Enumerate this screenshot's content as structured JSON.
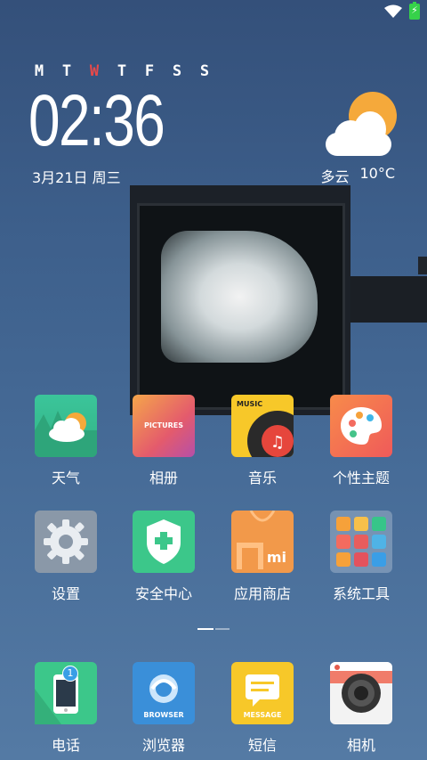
{
  "status": {
    "battery_icon": "battery-charging-icon",
    "wifi_icon": "wifi-icon"
  },
  "clock": {
    "weekdays": [
      "M",
      "T",
      "W",
      "T",
      "F",
      "S",
      "S"
    ],
    "active_day_index": 2,
    "time": "02:36",
    "date": "3月21日 周三"
  },
  "weather": {
    "condition": "多云",
    "temperature": "10°C",
    "icon": "partly-cloudy-icon"
  },
  "apps": [
    {
      "label": "天气",
      "icon": "weather-app-icon"
    },
    {
      "label": "相册",
      "icon": "gallery-app-icon",
      "icon_text": "PICTURES"
    },
    {
      "label": "音乐",
      "icon": "music-app-icon",
      "icon_text": "MUSIC"
    },
    {
      "label": "个性主题",
      "icon": "themes-app-icon"
    },
    {
      "label": "设置",
      "icon": "settings-app-icon"
    },
    {
      "label": "安全中心",
      "icon": "security-app-icon"
    },
    {
      "label": "应用商店",
      "icon": "app-store-icon",
      "icon_text": "mi"
    },
    {
      "label": "系统工具",
      "icon": "system-tools-folder-icon"
    }
  ],
  "dock": [
    {
      "label": "电话",
      "icon": "phone-app-icon",
      "badge": "1"
    },
    {
      "label": "浏览器",
      "icon": "browser-app-icon",
      "icon_text": "BROWSER"
    },
    {
      "label": "短信",
      "icon": "messages-app-icon",
      "icon_text": "MESSAGE"
    },
    {
      "label": "相机",
      "icon": "camera-app-icon"
    }
  ],
  "page_indicator": {
    "pages": 2,
    "current": 1
  }
}
